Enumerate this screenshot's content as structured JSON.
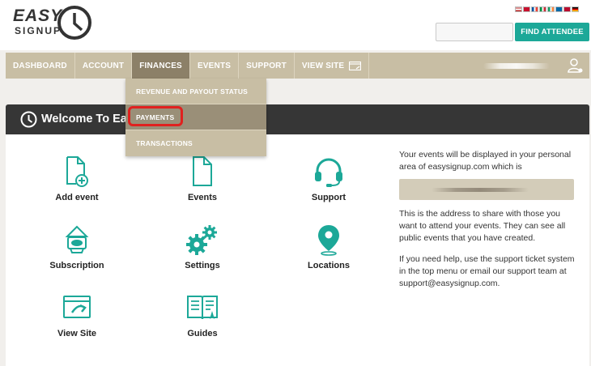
{
  "logo": {
    "word1": "EASY",
    "word2": "SIGNUP"
  },
  "flags": [
    "us",
    "dk",
    "fr",
    "it",
    "no",
    "se",
    "fi",
    "de"
  ],
  "header": {
    "find_button": "FIND ATTENDEE",
    "search_value": ""
  },
  "nav": {
    "items": [
      {
        "label": "DASHBOARD"
      },
      {
        "label": "ACCOUNT"
      },
      {
        "label": "FINANCES"
      },
      {
        "label": "EVENTS"
      },
      {
        "label": "SUPPORT"
      },
      {
        "label": "VIEW SITE"
      }
    ],
    "active": "FINANCES"
  },
  "dropdown": {
    "items": [
      {
        "label": "REVENUE AND PAYOUT STATUS"
      },
      {
        "label": "PAYMENTS"
      },
      {
        "label": "TRANSACTIONS"
      }
    ],
    "highlighted": "PAYMENTS"
  },
  "panel": {
    "title": "Welcome To Easy"
  },
  "tiles": [
    {
      "label": "Add event",
      "icon": "add-document-icon"
    },
    {
      "label": "Events",
      "icon": "document-icon"
    },
    {
      "label": "Support",
      "icon": "headset-icon"
    },
    {
      "label": "Subscription",
      "icon": "subscription-icon"
    },
    {
      "label": "Settings",
      "icon": "gears-icon"
    },
    {
      "label": "Locations",
      "icon": "location-pin-icon"
    },
    {
      "label": "View Site",
      "icon": "view-site-icon"
    },
    {
      "label": "Guides",
      "icon": "book-icon"
    }
  ],
  "sidebar": {
    "text1": "Your events will be displayed in your personal area of easysignup.com which is",
    "text2": "This is the address to share with those you want to attend your events. They can see all public events that you have created.",
    "text3": "If you need help, use the support ticket system in the top menu or email our support team at support@easysignup.com."
  },
  "colors": {
    "accent": "#1ca898",
    "nav": "#c8bea4",
    "nav_active": "#8c8068",
    "panel_head": "#363636"
  }
}
